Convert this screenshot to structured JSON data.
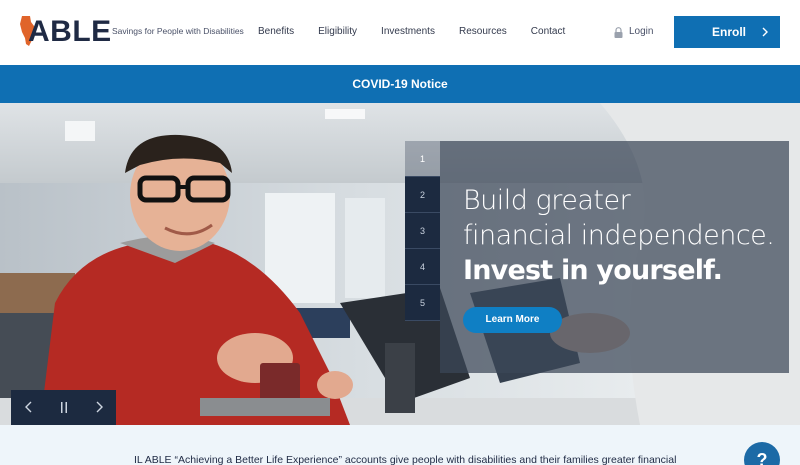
{
  "header": {
    "logo_text": "ABLE",
    "tagline": "Savings for People with Disabilities",
    "nav": [
      "Benefits",
      "Eligibility",
      "Investments",
      "Resources",
      "Contact"
    ],
    "login_label": "Login",
    "enroll_label": "Enroll"
  },
  "notice": {
    "text": "COVID-19 Notice"
  },
  "hero": {
    "line1": "Build greater",
    "line2": "financial independence.",
    "line3": "Invest in yourself.",
    "cta_label": "Learn More",
    "slides": [
      "1",
      "2",
      "3",
      "4",
      "5"
    ],
    "active_slide": 1
  },
  "intro": {
    "text": "IL ABLE “Achieving a Better Life Experience” accounts give people with disabilities and their families greater financial"
  },
  "help": {
    "label": "?"
  },
  "colors": {
    "brand_blue": "#0f6fb3",
    "navy": "#1f2a44",
    "logo_orange": "#e0642a"
  },
  "icons": {
    "logo": "illinois-state-icon",
    "login": "lock-icon",
    "enroll": "chevron-right-icon",
    "prev": "chevron-left-icon",
    "pause": "pause-icon",
    "next": "chevron-right-icon",
    "help": "help-icon"
  }
}
